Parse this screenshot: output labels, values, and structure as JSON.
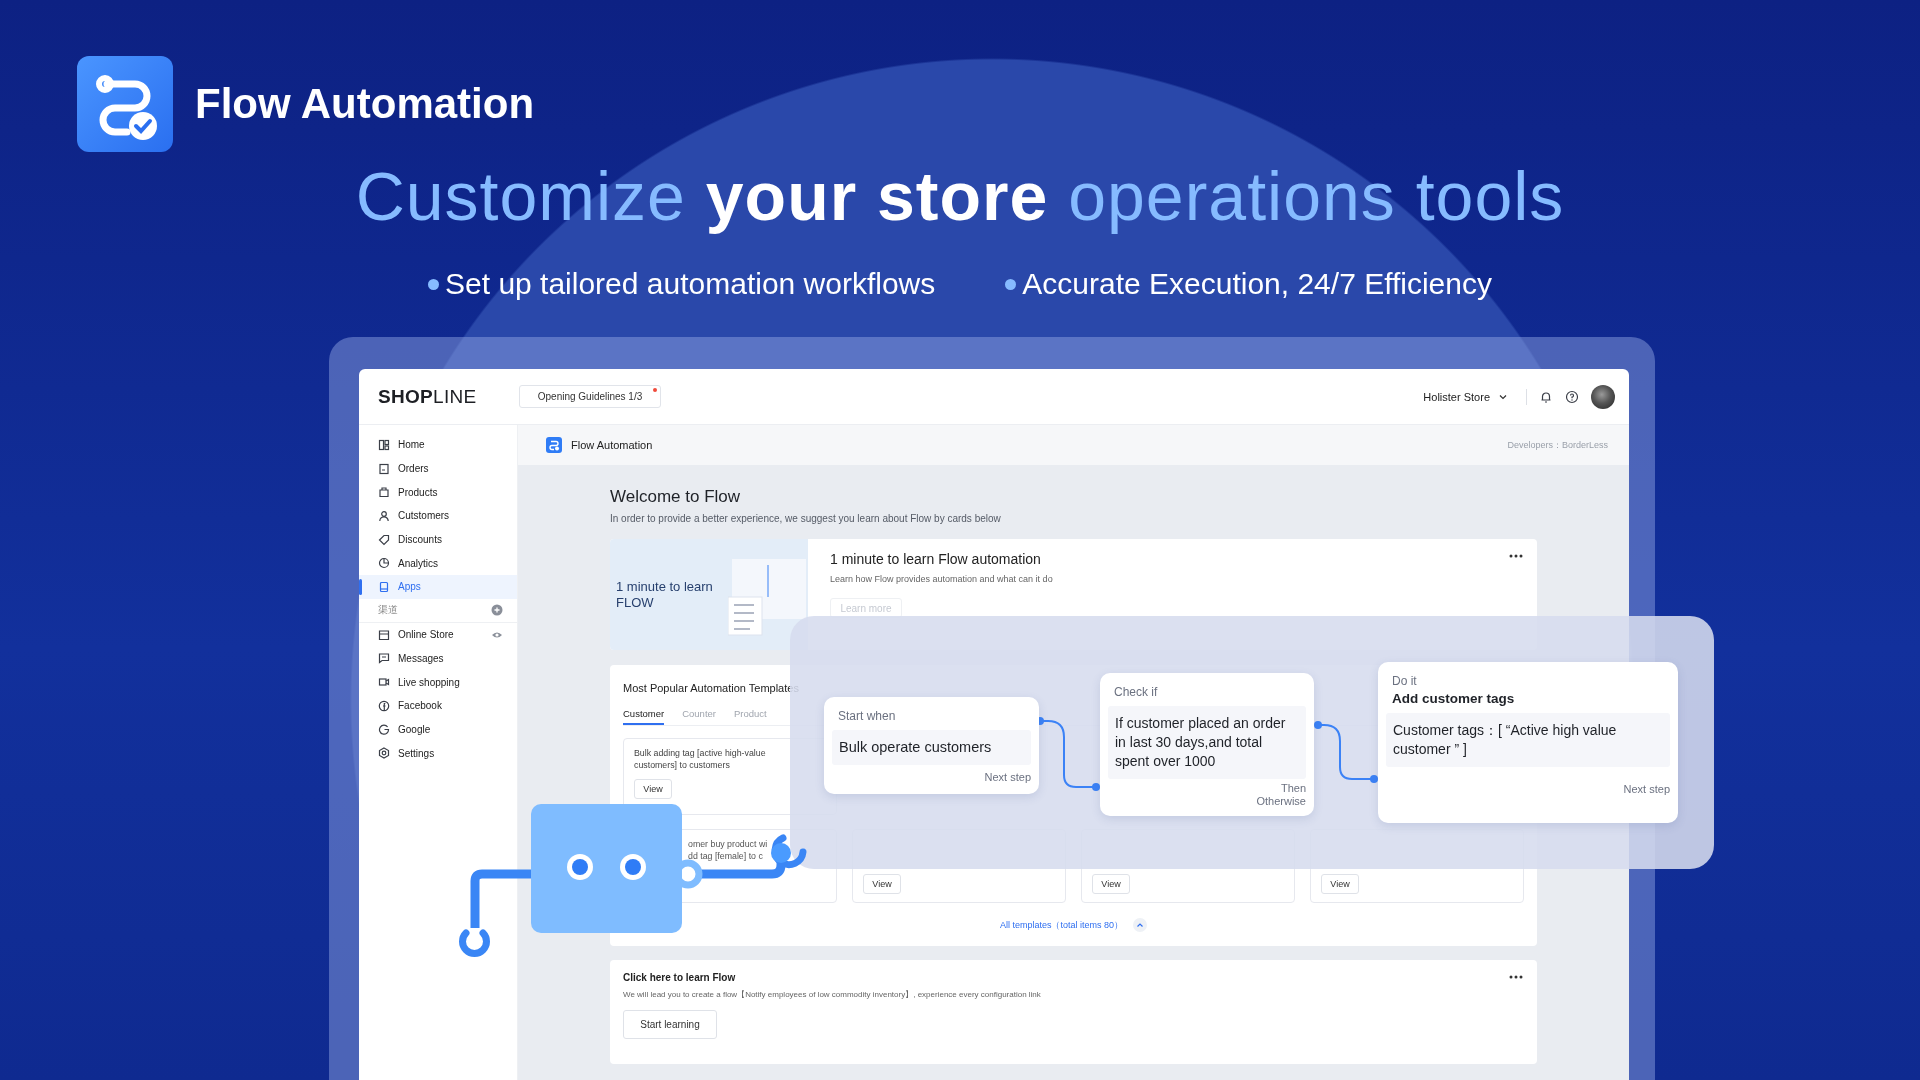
{
  "brand": {
    "name": "Flow Automation"
  },
  "headline": [
    {
      "text": "Customize",
      "highlight": true
    },
    {
      "text": "your store",
      "highlight": false
    },
    {
      "text": "operations tools",
      "highlight": true
    }
  ],
  "bullets": [
    "Set up tailored automation workflows",
    "Accurate Execution, 24/7 Efficiency"
  ],
  "app": {
    "logo": "**SHOP**LINE",
    "guide_button": {
      "label": "Opening Guidelines 1/3",
      "unread": true
    },
    "store": "Holister Store",
    "sidebar": {
      "items": [
        {
          "label": "Home",
          "selected": false
        },
        {
          "label": "Orders",
          "selected": false
        },
        {
          "label": "Products",
          "selected": false
        },
        {
          "label": "Cutstomers",
          "selected": false
        },
        {
          "label": "Discounts",
          "selected": false
        },
        {
          "label": "Analytics",
          "selected": false
        },
        {
          "label": "Apps",
          "selected": true
        }
      ],
      "section": "渠道",
      "channels": [
        {
          "label": "Online Store",
          "selected": false
        },
        {
          "label": "Messages",
          "selected": false
        },
        {
          "label": "Live shopping",
          "selected": false
        },
        {
          "label": "Facebook",
          "selected": false
        },
        {
          "label": "Google",
          "selected": false
        },
        {
          "label": "Settings",
          "selected": false
        }
      ]
    },
    "page_header": {
      "title": "Flow Automation",
      "developer": "Developers：BorderLess"
    },
    "welcome": {
      "title": "Welcome to Flow",
      "subtitle": "In order to provide a better experience, we suggest you learn about Flow by cards below"
    },
    "intro_card": {
      "image_caption": [
        "1 minute to learn",
        "FLOW"
      ],
      "title": "1 minute to learn Flow automation",
      "description": "Learn how Flow provides automation and what can it do",
      "button": "Learn more"
    },
    "templates": {
      "title": "Most Popular Automation Templates",
      "tabs": [
        {
          "label": "Customer",
          "selected": true
        },
        {
          "label": "Counter",
          "selected": false
        },
        {
          "label": "Product",
          "selected": false
        }
      ],
      "rows": [
        [
          {
            "lines": [
              "Bulk adding tag [active high-value",
              "customers] to customers"
            ],
            "button": "View"
          }
        ],
        [
          {
            "lines": [
              "omer buy product wi",
              "dd tag [female] to c"
            ]
          },
          {
            "button": "View"
          },
          {
            "button": "View"
          },
          {
            "button": "View"
          }
        ]
      ],
      "footer": "All templates（total items 80）"
    },
    "learn_card": {
      "title": "Click here to learn Flow",
      "description": "We will lead you to create a flow【Notify employees of low commodity inventory】, experience every configuration link",
      "button": "Start learning"
    }
  },
  "flow": {
    "steps": [
      {
        "kind": "trigger",
        "label": "Start when",
        "body": "Bulk operate customers",
        "footer": [
          "Next step"
        ]
      },
      {
        "kind": "condition",
        "label": "Check if",
        "body": "If customer placed an order in last 30 days,and total spent over 1000",
        "footer": [
          "Then",
          "Otherwise"
        ]
      },
      {
        "kind": "action",
        "label": "Do it",
        "title": "Add customer tags",
        "body": "Customer tags：[ “Active high value customer ” ]",
        "footer": [
          "Next step"
        ]
      }
    ]
  }
}
